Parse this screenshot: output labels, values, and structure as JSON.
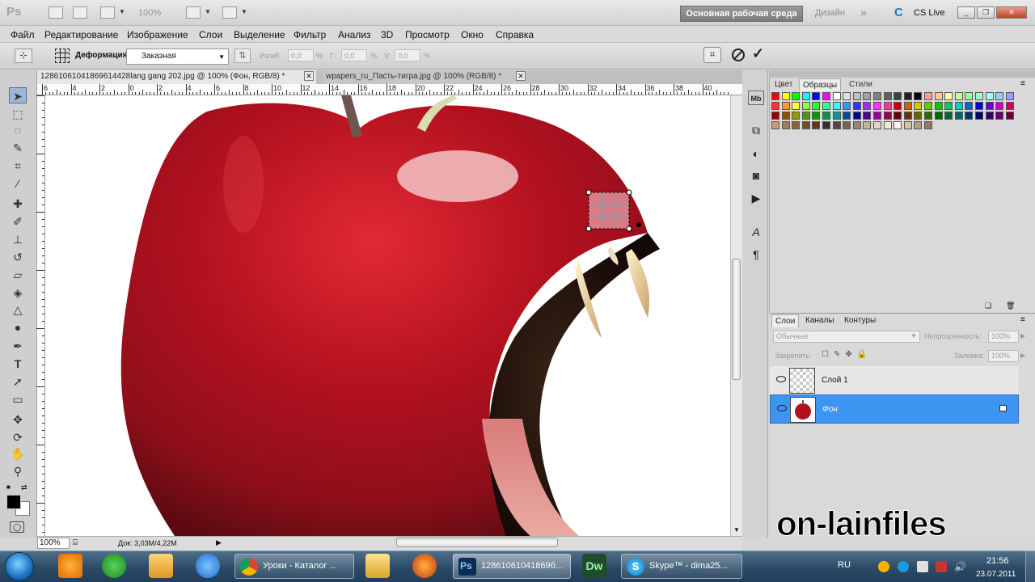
{
  "appbar": {
    "logo": "Ps",
    "zoom": "100%",
    "workspace_button": "Основная рабочая среда",
    "design_button": "Дизайн",
    "cs_live": "CS Live"
  },
  "menu": [
    "Файл",
    "Редактирование",
    "Изображение",
    "Слои",
    "Выделение",
    "Фильтр",
    "Анализ",
    "3D",
    "Просмотр",
    "Окно",
    "Справка"
  ],
  "options": {
    "deform_label": "Деформация:",
    "deform_value": "Заказная",
    "bend_label": "Изгиб:",
    "bend_value": "0,0",
    "h_label": "Г:",
    "h_value": "0,0",
    "v_label": "V:",
    "v_value": "0,0",
    "pct": "%"
  },
  "tabs": [
    {
      "label": "12861061041869614428lang gang 202.jpg @ 100% (Фон, RGB/8) *"
    },
    {
      "label": "wpapers_ru_Пасть-тигра.jpg @ 100% (RGB/8) *"
    }
  ],
  "ruler_top": [
    "6",
    "4",
    "2",
    "0",
    "2",
    "4",
    "6",
    "8",
    "10",
    "12",
    "14",
    "16",
    "18",
    "20",
    "22",
    "24",
    "26",
    "28",
    "30",
    "32",
    "34",
    "36",
    "38",
    "40"
  ],
  "status": {
    "zoom": "100%",
    "doc": "Док: 3,03M/4,22M"
  },
  "panels": {
    "tab_color": "Цвет",
    "tab_swatches": "Образцы",
    "tab_styles": "Стили",
    "tab_layers": "Слои",
    "tab_channels": "Каналы",
    "tab_paths": "Контуры",
    "blend_mode": "Обычные",
    "opacity_label": "Непрозрачность:",
    "opacity_value": "100%",
    "lock_label": "Закрепить:",
    "fill_label": "Заливка:",
    "fill_value": "100%"
  },
  "layers": [
    {
      "name": "Слой 1"
    },
    {
      "name": "Фон"
    }
  ],
  "swatches": {
    "row1": [
      "#ff0000",
      "#ffff00",
      "#00ff00",
      "#00ffff",
      "#0000ff",
      "#ff00ff",
      "#ffffff",
      "#e0e0e0",
      "#c0c0c0",
      "#a0a0a0",
      "#808080",
      "#606060",
      "#404040",
      "#202020",
      "#000000",
      "#ff9999",
      "#ffcc99",
      "#ffff99",
      "#ccff99",
      "#99ff99",
      "#99ffcc",
      "#99ffff",
      "#99ccff",
      "#9999ff"
    ],
    "row2": [
      "#ff3333",
      "#ff9933",
      "#ffff33",
      "#99ff33",
      "#33ff33",
      "#33ff99",
      "#33ffff",
      "#3399ff",
      "#3333ff",
      "#9933ff",
      "#ff33ff",
      "#ff3399",
      "#cc0000",
      "#cc6600",
      "#cccc00",
      "#66cc00",
      "#00cc00",
      "#00cc66",
      "#00cccc",
      "#0066cc",
      "#0000cc",
      "#6600cc",
      "#cc00cc",
      "#cc0066"
    ],
    "row3": [
      "#990000",
      "#994c00",
      "#999900",
      "#4c9900",
      "#009900",
      "#00994c",
      "#009999",
      "#004c99",
      "#000099",
      "#4c0099",
      "#990099",
      "#99004c",
      "#660000",
      "#663300",
      "#666600",
      "#336600",
      "#006600",
      "#006633",
      "#006666",
      "#003366",
      "#000066",
      "#330066",
      "#660066",
      "#660033"
    ],
    "row4": [
      "#c69c6d",
      "#a67c52",
      "#8c6239",
      "#754c24",
      "#603913",
      "#362f2d",
      "#534741",
      "#736357",
      "#998675",
      "#c7b299",
      "#e5d5bf",
      "#f2e8dc",
      "#fff7ee",
      "#d9c3a5",
      "#b59a7c",
      "#8f7a63"
    ]
  },
  "taskbar": {
    "windows": [
      "Уроки - Каталог ...",
      "12861061041869б...",
      "Skype™ - dima25..."
    ],
    "lang": "RU",
    "time": "21:56",
    "date": "23.07.2011"
  },
  "watermark": "on-lainfiles"
}
